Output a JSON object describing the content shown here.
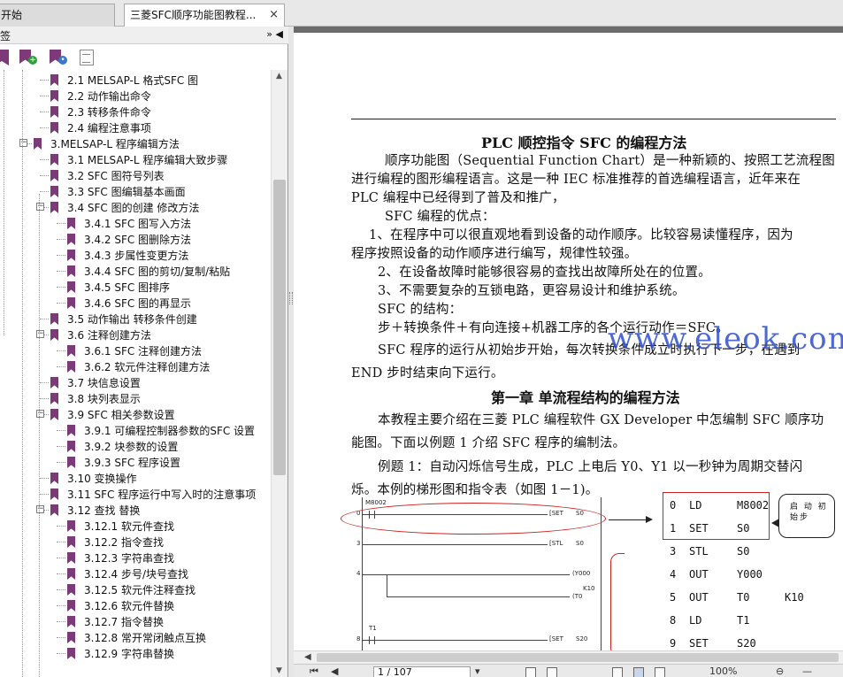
{
  "tabs": {
    "start_label": "开始",
    "doc_label": "三菱SFC顺序功能图教程...",
    "close_glyph": "×"
  },
  "left_panel": {
    "title": "签",
    "collapse_glyph": "»",
    "arrow_glyph": "◀",
    "tools": [
      "new-bookmark-icon",
      "bookmark-search-icon",
      "bookmark-document-icon"
    ]
  },
  "bookmarks": [
    {
      "label": "2.1 MELSAP-L 格式SFC 图",
      "level": 1,
      "expander": ""
    },
    {
      "label": "2.2 动作输出命令",
      "level": 1,
      "expander": ""
    },
    {
      "label": "2.3 转移条件命令",
      "level": 1,
      "expander": ""
    },
    {
      "label": "2.4 编程注意事项",
      "level": 1,
      "expander": ""
    },
    {
      "label": "3.MELSAP-L 程序编辑方法",
      "level": 0,
      "expander": "−"
    },
    {
      "label": "3.1 MELSAP-L 程序编辑大致步骤",
      "level": 1,
      "expander": ""
    },
    {
      "label": "3.2 SFC 图符号列表",
      "level": 1,
      "expander": ""
    },
    {
      "label": "3.3 SFC 图编辑基本画面",
      "level": 1,
      "expander": ""
    },
    {
      "label": "3.4 SFC 图的创建 修改方法",
      "level": 1,
      "expander": "−"
    },
    {
      "label": "3.4.1 SFC 图写入方法",
      "level": 2,
      "expander": ""
    },
    {
      "label": "3.4.2 SFC 图删除方法",
      "level": 2,
      "expander": ""
    },
    {
      "label": "3.4.3 步属性变更方法",
      "level": 2,
      "expander": ""
    },
    {
      "label": "3.4.4 SFC 图的剪切/复制/粘贴",
      "level": 2,
      "expander": ""
    },
    {
      "label": "3.4.5 SFC 图排序",
      "level": 2,
      "expander": ""
    },
    {
      "label": "3.4.6 SFC 图的再显示",
      "level": 2,
      "expander": ""
    },
    {
      "label": "3.5 动作输出 转移条件创建",
      "level": 1,
      "expander": ""
    },
    {
      "label": "3.6 注释创建方法",
      "level": 1,
      "expander": "−"
    },
    {
      "label": "3.6.1 SFC 注释创建方法",
      "level": 2,
      "expander": ""
    },
    {
      "label": "3.6.2 软元件注释创建方法",
      "level": 2,
      "expander": ""
    },
    {
      "label": "3.7 块信息设置",
      "level": 1,
      "expander": ""
    },
    {
      "label": "3.8 块列表显示",
      "level": 1,
      "expander": ""
    },
    {
      "label": "3.9 SFC 相关参数设置",
      "level": 1,
      "expander": "−"
    },
    {
      "label": "3.9.1 可编程控制器参数的SFC 设置",
      "level": 2,
      "expander": ""
    },
    {
      "label": "3.9.2 块参数的设置",
      "level": 2,
      "expander": ""
    },
    {
      "label": "3.9.3 SFC 程序设置",
      "level": 2,
      "expander": ""
    },
    {
      "label": "3.10 变换操作",
      "level": 1,
      "expander": ""
    },
    {
      "label": "3.11 SFC 程序运行中写入时的注意事项",
      "level": 1,
      "expander": ""
    },
    {
      "label": "3.12 查找 替换",
      "level": 1,
      "expander": "−"
    },
    {
      "label": "3.12.1 软元件查找",
      "level": 2,
      "expander": ""
    },
    {
      "label": "3.12.2 指令查找",
      "level": 2,
      "expander": ""
    },
    {
      "label": "3.12.3 字符串查找",
      "level": 2,
      "expander": ""
    },
    {
      "label": "3.12.4 步号/块号查找",
      "level": 2,
      "expander": ""
    },
    {
      "label": "3.12.5 软元件注释查找",
      "level": 2,
      "expander": ""
    },
    {
      "label": "3.12.6 软元件替换",
      "level": 2,
      "expander": ""
    },
    {
      "label": "3.12.7 指令替换",
      "level": 2,
      "expander": ""
    },
    {
      "label": "3.12.8 常开常闭触点互换",
      "level": 2,
      "expander": ""
    },
    {
      "label": "3.12.9 字符串替换",
      "level": 2,
      "expander": ""
    }
  ],
  "document": {
    "title": "PLC 顺控指令 SFC 的编程方法",
    "paragraphs": [
      "顺序功能图（Sequential Function Chart）是一种新颖的、按照工艺流程图",
      "进行编程的图形编程语言。这是一种 IEC 标准推荐的首选编程语言，近年来在",
      "PLC 编程中已经得到了普及和推广，",
      "SFC 编程的优点：",
      "1、在程序中可以很直观地看到设备的动作顺序。比较容易读懂程序，因为",
      "程序按照设备的动作顺序进行编写，规律性较强。",
      "2、在设备故障时能够很容易的查找出故障所处在的位置。",
      "3、不需要复杂的互锁电路，更容易设计和维护系统。",
      "SFC 的结构：",
      "步＋转换条件＋有向连接+机器工序的各个运行动作＝SFC。",
      "SFC 程序的运行从初始步开始，每次转换条件成立时执行下一步，在遇到",
      "END 步时结束向下运行。"
    ],
    "chapter_title": "第一章  单流程结构的编程方法",
    "chapter_paragraphs": [
      "本教程主要介绍在三菱 PLC 编程软件 GX Developer 中怎编制 SFC 顺序功",
      "能图。下面以例题 1 介绍 SFC 程序的编制法。",
      "例题 1：自动闪烁信号生成，PLC 上电后 Y0、Y1 以一秒钟为周期交替闪",
      "烁。本例的梯形图和指令表（如图 1－1)。"
    ],
    "watermark": "www.eleok.com"
  },
  "ladder": {
    "labels": [
      "M8002",
      "0",
      "[SET",
      "S0",
      "3",
      "[STL",
      "S0",
      "4",
      "(Y000",
      "K10",
      "(T0",
      "T1",
      "8",
      "[SET",
      "S20"
    ]
  },
  "instructions": [
    [
      "0",
      "LD",
      "M8002",
      ""
    ],
    [
      "1",
      "SET",
      "S0",
      ""
    ],
    [
      "3",
      "STL",
      "S0",
      ""
    ],
    [
      "4",
      "OUT",
      "Y000",
      ""
    ],
    [
      "5",
      "OUT",
      "T0",
      "K10"
    ],
    [
      "8",
      "LD",
      "T1",
      ""
    ],
    [
      "9",
      "SET",
      "S20",
      ""
    ]
  ],
  "callout": "启 动 初 始步",
  "status": {
    "page_value": "1 / 107",
    "zoom": "100%"
  }
}
